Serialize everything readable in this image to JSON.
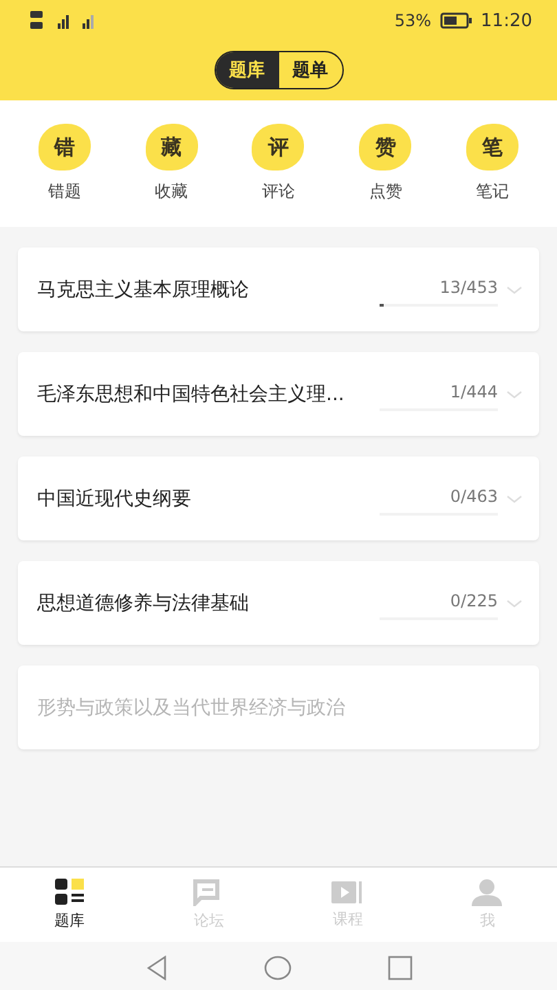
{
  "status_bar": {
    "battery_text": "53%",
    "time": "11:20"
  },
  "segments": [
    {
      "label": "题库",
      "selected": true
    },
    {
      "label": "题单",
      "selected": false
    }
  ],
  "shortcuts": [
    {
      "glyph": "错",
      "label": "错题"
    },
    {
      "glyph": "藏",
      "label": "收藏"
    },
    {
      "glyph": "评",
      "label": "评论"
    },
    {
      "glyph": "赞",
      "label": "点赞"
    },
    {
      "glyph": "笔",
      "label": "笔记"
    }
  ],
  "subjects": [
    {
      "title": "马克思主义基本原理概论",
      "count": "13/453",
      "level": 0.03,
      "disabled": false
    },
    {
      "title": "毛泽东思想和中国特色社会主义理...",
      "count": "1/444",
      "disabled": false
    },
    {
      "title": "中国近现代史纲要",
      "count": "0/463",
      "disabled": false
    },
    {
      "title": "思想道德修养与法律基础",
      "count": "0/225",
      "disabled": false
    },
    {
      "title": "形势与政策以及当代世界经济与政治",
      "disabled": true
    }
  ],
  "tab_bar": [
    {
      "label": "题库",
      "kind": "grid",
      "selected": true
    },
    {
      "label": "论坛",
      "kind": "chat",
      "selected": false
    },
    {
      "label": "课程",
      "kind": "video",
      "selected": false
    },
    {
      "label": "我",
      "kind": "person",
      "selected": false
    }
  ]
}
